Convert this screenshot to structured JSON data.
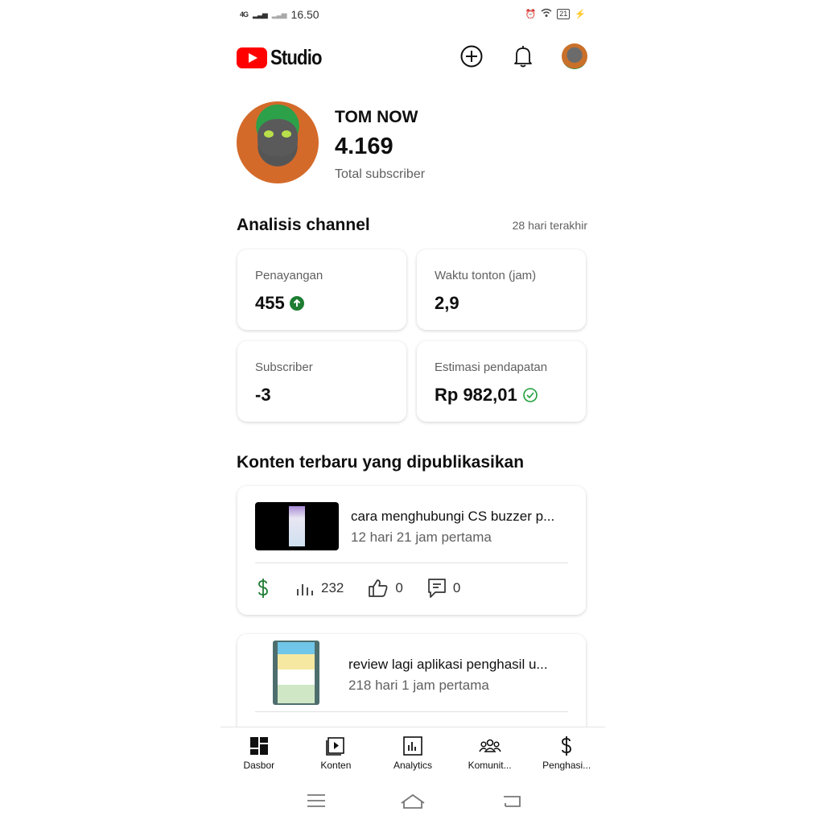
{
  "status_bar": {
    "signal": "4G",
    "time": "16.50",
    "battery": "21"
  },
  "header": {
    "logo_text": "Studio"
  },
  "channel": {
    "name": "TOM NOW",
    "subscribers": "4.169",
    "subscribers_label": "Total subscriber"
  },
  "analytics": {
    "title": "Analisis channel",
    "period": "28 hari terakhir",
    "metrics": [
      {
        "label": "Penayangan",
        "value": "455",
        "indicator": "arrow-up-circle-icon",
        "indicator_color": "#1e7d32"
      },
      {
        "label": "Waktu tonton (jam)",
        "value": "2,9"
      },
      {
        "label": "Subscriber",
        "value": "-3"
      },
      {
        "label": "Estimasi pendapatan",
        "value": "Rp 982,01",
        "indicator": "check-circle-icon",
        "indicator_color": "#1e9e3a"
      }
    ]
  },
  "recent": {
    "title": "Konten terbaru yang dipublikasikan",
    "items": [
      {
        "title": "cara menghubungi CS buzzer p...",
        "subtitle": "12 hari 21 jam pertama",
        "views": "232",
        "likes": "0",
        "comments": "0"
      },
      {
        "title": "review lagi aplikasi penghasil u...",
        "subtitle": "218 hari 1 jam pertama"
      }
    ]
  },
  "bottom_nav": [
    {
      "label": "Dasbor",
      "icon": "dashboard-icon"
    },
    {
      "label": "Konten",
      "icon": "content-icon"
    },
    {
      "label": "Analytics",
      "icon": "analytics-icon"
    },
    {
      "label": "Komunit...",
      "icon": "community-icon"
    },
    {
      "label": "Penghasi...",
      "icon": "earn-icon"
    }
  ],
  "colors": {
    "brand_red": "#ff0000",
    "green": "#1e7d32",
    "text_secondary": "#606060"
  }
}
